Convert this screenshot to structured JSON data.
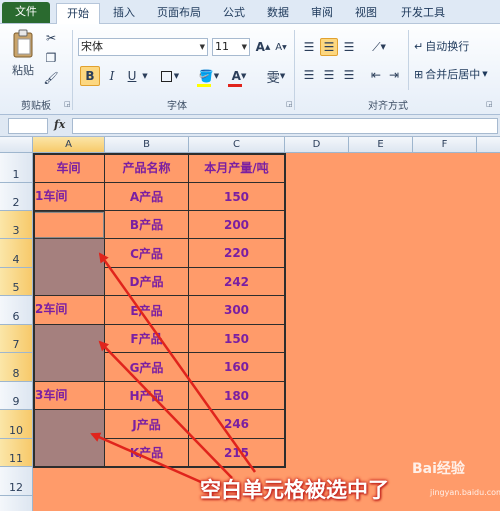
{
  "ribbon_tabs": [
    "文件",
    "开始",
    "插入",
    "页面布局",
    "公式",
    "数据",
    "审阅",
    "视图",
    "开发工具"
  ],
  "clipboard": {
    "paste_label": "粘贴",
    "group_label": "剪贴板"
  },
  "font": {
    "name": "宋体",
    "size": "11",
    "bold": "B",
    "italic": "I",
    "underline": "U",
    "group_label": "字体",
    "grow": "A",
    "shrink": "A"
  },
  "alignment": {
    "wrap_label": "自动换行",
    "merge_label": "合并后居中",
    "group_label": "对齐方式"
  },
  "formula_bar": {
    "fx": "fx",
    "value": ""
  },
  "columns": [
    "A",
    "B",
    "C",
    "D",
    "E",
    "F"
  ],
  "rows": [
    "1",
    "2",
    "3",
    "4",
    "5",
    "6",
    "7",
    "8",
    "9",
    "10",
    "11",
    "12"
  ],
  "table": {
    "headers": [
      "车间",
      "产品名称",
      "本月产量/吨"
    ],
    "workshops": [
      "1车间",
      "2车间",
      "3车间"
    ],
    "products": [
      "A产品",
      "B产品",
      "C产品",
      "D产品",
      "E产品",
      "F产品",
      "G产品",
      "H产品",
      "J产品",
      "K产品"
    ],
    "quantities": [
      "150",
      "200",
      "220",
      "242",
      "300",
      "150",
      "160",
      "180",
      "246",
      "215"
    ]
  },
  "annotation": "空白单元格被选中了",
  "watermark": {
    "main": "Bai经验",
    "sub": "jingyan.baidu.com"
  },
  "colors": {
    "sheet_bg": "#ff9b6a",
    "selected_gray": "#a5807e",
    "text_purple": "#7a1fa2",
    "arrow_red": "#e0241c"
  }
}
